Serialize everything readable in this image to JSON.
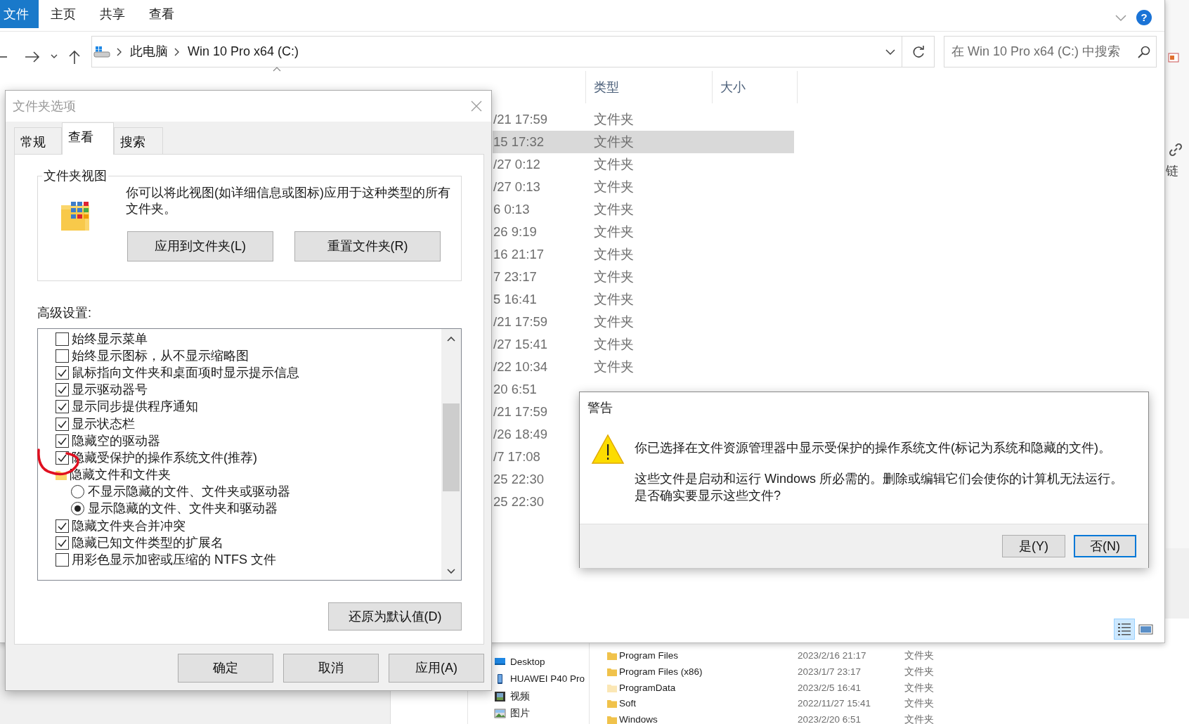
{
  "explorer": {
    "ribbon_tabs": [
      {
        "label": "文件",
        "kind": "file"
      },
      {
        "label": "主页",
        "kind": "tab"
      },
      {
        "label": "共享",
        "kind": "tab"
      },
      {
        "label": "查看",
        "kind": "tab"
      }
    ],
    "help_label": "?",
    "address": {
      "path": [
        "此电脑",
        "Win 10 Pro x64 (C:)"
      ]
    },
    "search": {
      "placeholder": "在 Win 10 Pro x64 (C:) 中搜索"
    },
    "columns": [
      "类型",
      "大小"
    ],
    "rows": [
      {
        "date": "/21 17:59",
        "type": "文件夹",
        "selected": false
      },
      {
        "date": "15 17:32",
        "type": "文件夹",
        "selected": true
      },
      {
        "date": "/27 0:12",
        "type": "文件夹",
        "selected": false
      },
      {
        "date": "/27 0:13",
        "type": "文件夹",
        "selected": false
      },
      {
        "date": "6 0:13",
        "type": "文件夹",
        "selected": false
      },
      {
        "date": "26 9:19",
        "type": "文件夹",
        "selected": false
      },
      {
        "date": "16 21:17",
        "type": "文件夹",
        "selected": false
      },
      {
        "date": "7 23:17",
        "type": "文件夹",
        "selected": false
      },
      {
        "date": "5 16:41",
        "type": "文件夹",
        "selected": false
      },
      {
        "date": "/21 17:59",
        "type": "文件夹",
        "selected": false
      },
      {
        "date": "/27 15:41",
        "type": "文件夹",
        "selected": false
      },
      {
        "date": "/22 10:34",
        "type": "文件夹",
        "selected": false
      },
      {
        "date": "20 6:51",
        "selected": false
      },
      {
        "date": "/21 17:59",
        "selected": false
      },
      {
        "date": "/26 18:49",
        "selected": false
      },
      {
        "date": "/7 17:08",
        "selected": false
      },
      {
        "date": "25 22:30",
        "selected": false
      },
      {
        "date": "25 22:30",
        "selected": false
      }
    ],
    "view_modes": [
      {
        "kind": "details",
        "selected": true
      },
      {
        "kind": "large-icons",
        "selected": false
      }
    ]
  },
  "side_window": {
    "label": "链"
  },
  "back_window": {
    "nav": [
      {
        "label": "Desktop",
        "kind": "desktop"
      },
      {
        "label": "HUAWEI P40 Pro",
        "kind": "phone"
      },
      {
        "label": "视频",
        "kind": "video"
      },
      {
        "label": "图片",
        "kind": "pictures"
      }
    ],
    "files": [
      {
        "name": "Program Files",
        "date": "2023/2/16 21:17",
        "type": "文件夹",
        "hidden": false
      },
      {
        "name": "Program Files (x86)",
        "date": "2023/1/7 23:17",
        "type": "文件夹",
        "hidden": false
      },
      {
        "name": "ProgramData",
        "date": "2023/2/5 16:41",
        "type": "文件夹",
        "hidden": true
      },
      {
        "name": "Soft",
        "date": "2022/11/27 15:41",
        "type": "文件夹",
        "hidden": false
      },
      {
        "name": "Windows",
        "date": "2023/2/20 6:51",
        "type": "文件夹",
        "hidden": false
      }
    ]
  },
  "folder_options": {
    "title": "文件夹选项",
    "tabs": [
      {
        "label": "常规",
        "selected": false
      },
      {
        "label": "查看",
        "selected": true
      },
      {
        "label": "搜索",
        "selected": false
      }
    ],
    "group_title": "文件夹视图",
    "group_text": "你可以将此视图(如详细信息或图标)应用于这种类型的所有文件夹。",
    "group_buttons": [
      "应用到文件夹(L)",
      "重置文件夹(R)"
    ],
    "advanced_label": "高级设置:",
    "settings": [
      {
        "kind": "checkbox",
        "label": "始终显示菜单",
        "checked": false
      },
      {
        "kind": "checkbox",
        "label": "始终显示图标，从不显示缩略图",
        "checked": false
      },
      {
        "kind": "checkbox",
        "label": "鼠标指向文件夹和桌面项时显示提示信息",
        "checked": true
      },
      {
        "kind": "checkbox",
        "label": "显示驱动器号",
        "checked": true
      },
      {
        "kind": "checkbox",
        "label": "显示同步提供程序通知",
        "checked": true
      },
      {
        "kind": "checkbox",
        "label": "显示状态栏",
        "checked": true
      },
      {
        "kind": "checkbox",
        "label": "隐藏空的驱动器",
        "checked": true
      },
      {
        "kind": "checkbox",
        "label": "隐藏受保护的操作系统文件(推荐)",
        "checked": true
      },
      {
        "kind": "folder",
        "label": "隐藏文件和文件夹",
        "children": [
          {
            "kind": "radio",
            "label": "不显示隐藏的文件、文件夹或驱动器",
            "selected": false
          },
          {
            "kind": "radio",
            "label": "显示隐藏的文件、文件夹和驱动器",
            "selected": true
          }
        ]
      },
      {
        "kind": "checkbox",
        "label": "隐藏文件夹合并冲突",
        "checked": true
      },
      {
        "kind": "checkbox",
        "label": "隐藏已知文件类型的扩展名",
        "checked": true
      },
      {
        "kind": "checkbox",
        "label": "用彩色显示加密或压缩的 NTFS 文件",
        "checked": false
      }
    ],
    "restore_button": "还原为默认值(D)",
    "buttons": [
      "确定",
      "取消",
      "应用(A)"
    ]
  },
  "warning": {
    "title": "警告",
    "paragraphs": [
      [
        "你已选择在文件资源管理器中显示受保护的操作系统文件(标记为系统和隐藏的文件)。"
      ],
      [
        "这些文件是启动和运行 Windows 所必需的。删除或编辑它们会使你的计算机无法运行。",
        "是否确实要显示这些文件?"
      ]
    ],
    "buttons": [
      {
        "label": "是(Y)",
        "default": false
      },
      {
        "label": "否(N)",
        "default": true
      }
    ]
  }
}
